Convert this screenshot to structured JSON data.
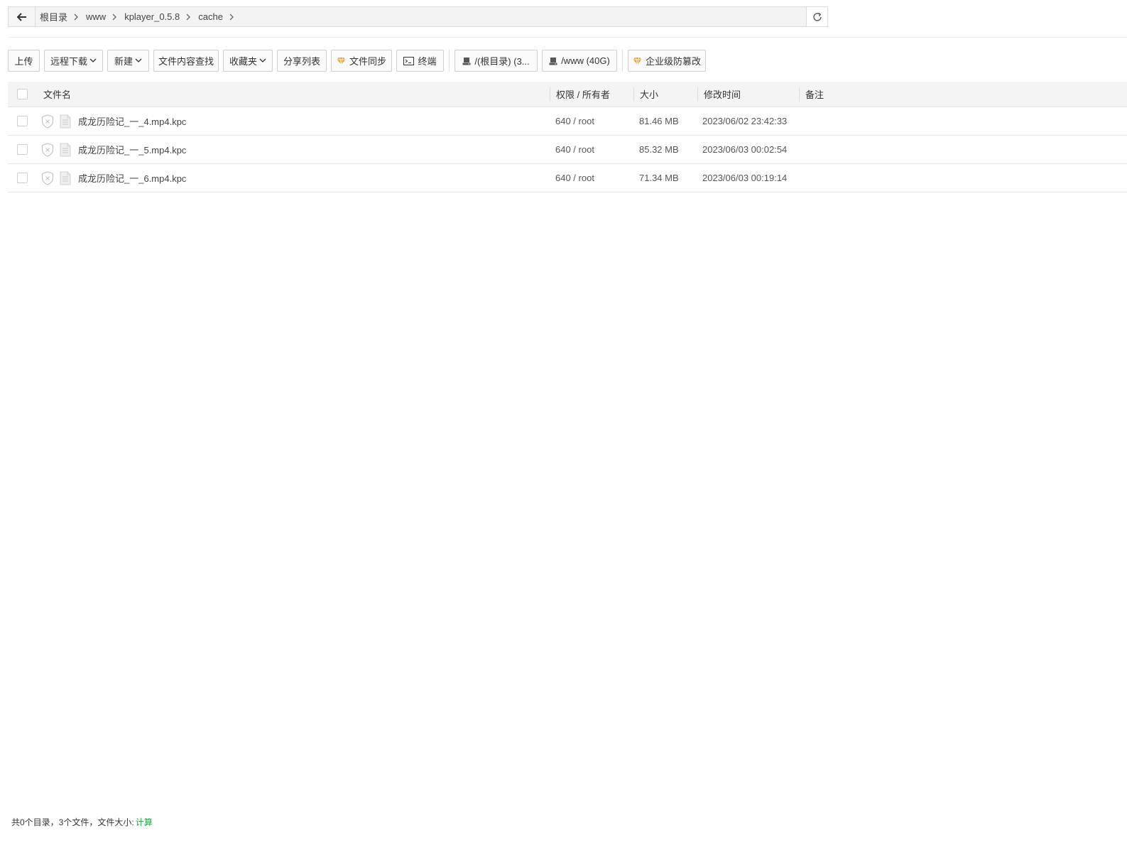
{
  "breadcrumb": {
    "items": [
      "根目录",
      "www",
      "kplayer_0.5.8",
      "cache"
    ]
  },
  "toolbar": {
    "upload": "上传",
    "remote_download": "远程下载",
    "new": "新建",
    "content_search": "文件内容查找",
    "favorites": "收藏夹",
    "share_list": "分享列表",
    "file_sync": "文件同步",
    "terminal": "终端",
    "disk_root": "/(根目录) (3...",
    "disk_www": "/www (40G)",
    "tamper_proof": "企业级防篡改"
  },
  "table": {
    "headers": {
      "name": "文件名",
      "permission": "权限 / 所有者",
      "size": "大小",
      "mtime": "修改时间",
      "note": "备注"
    },
    "rows": [
      {
        "name": "成龙历险记_一_4.mp4.kpc",
        "permission": "640 / root",
        "size": "81.46 MB",
        "mtime": "2023/06/02 23:42:33",
        "note": ""
      },
      {
        "name": "成龙历险记_一_5.mp4.kpc",
        "permission": "640 / root",
        "size": "85.32 MB",
        "mtime": "2023/06/03 00:02:54",
        "note": ""
      },
      {
        "name": "成龙历险记_一_6.mp4.kpc",
        "permission": "640 / root",
        "size": "71.34 MB",
        "mtime": "2023/06/03 00:19:14",
        "note": ""
      }
    ]
  },
  "footer": {
    "summary": "共0个目录，3个文件，文件大小:",
    "calc_link": "计算"
  },
  "colors": {
    "accent_green": "#20a53a",
    "gem_orange": "#e8a23a"
  }
}
